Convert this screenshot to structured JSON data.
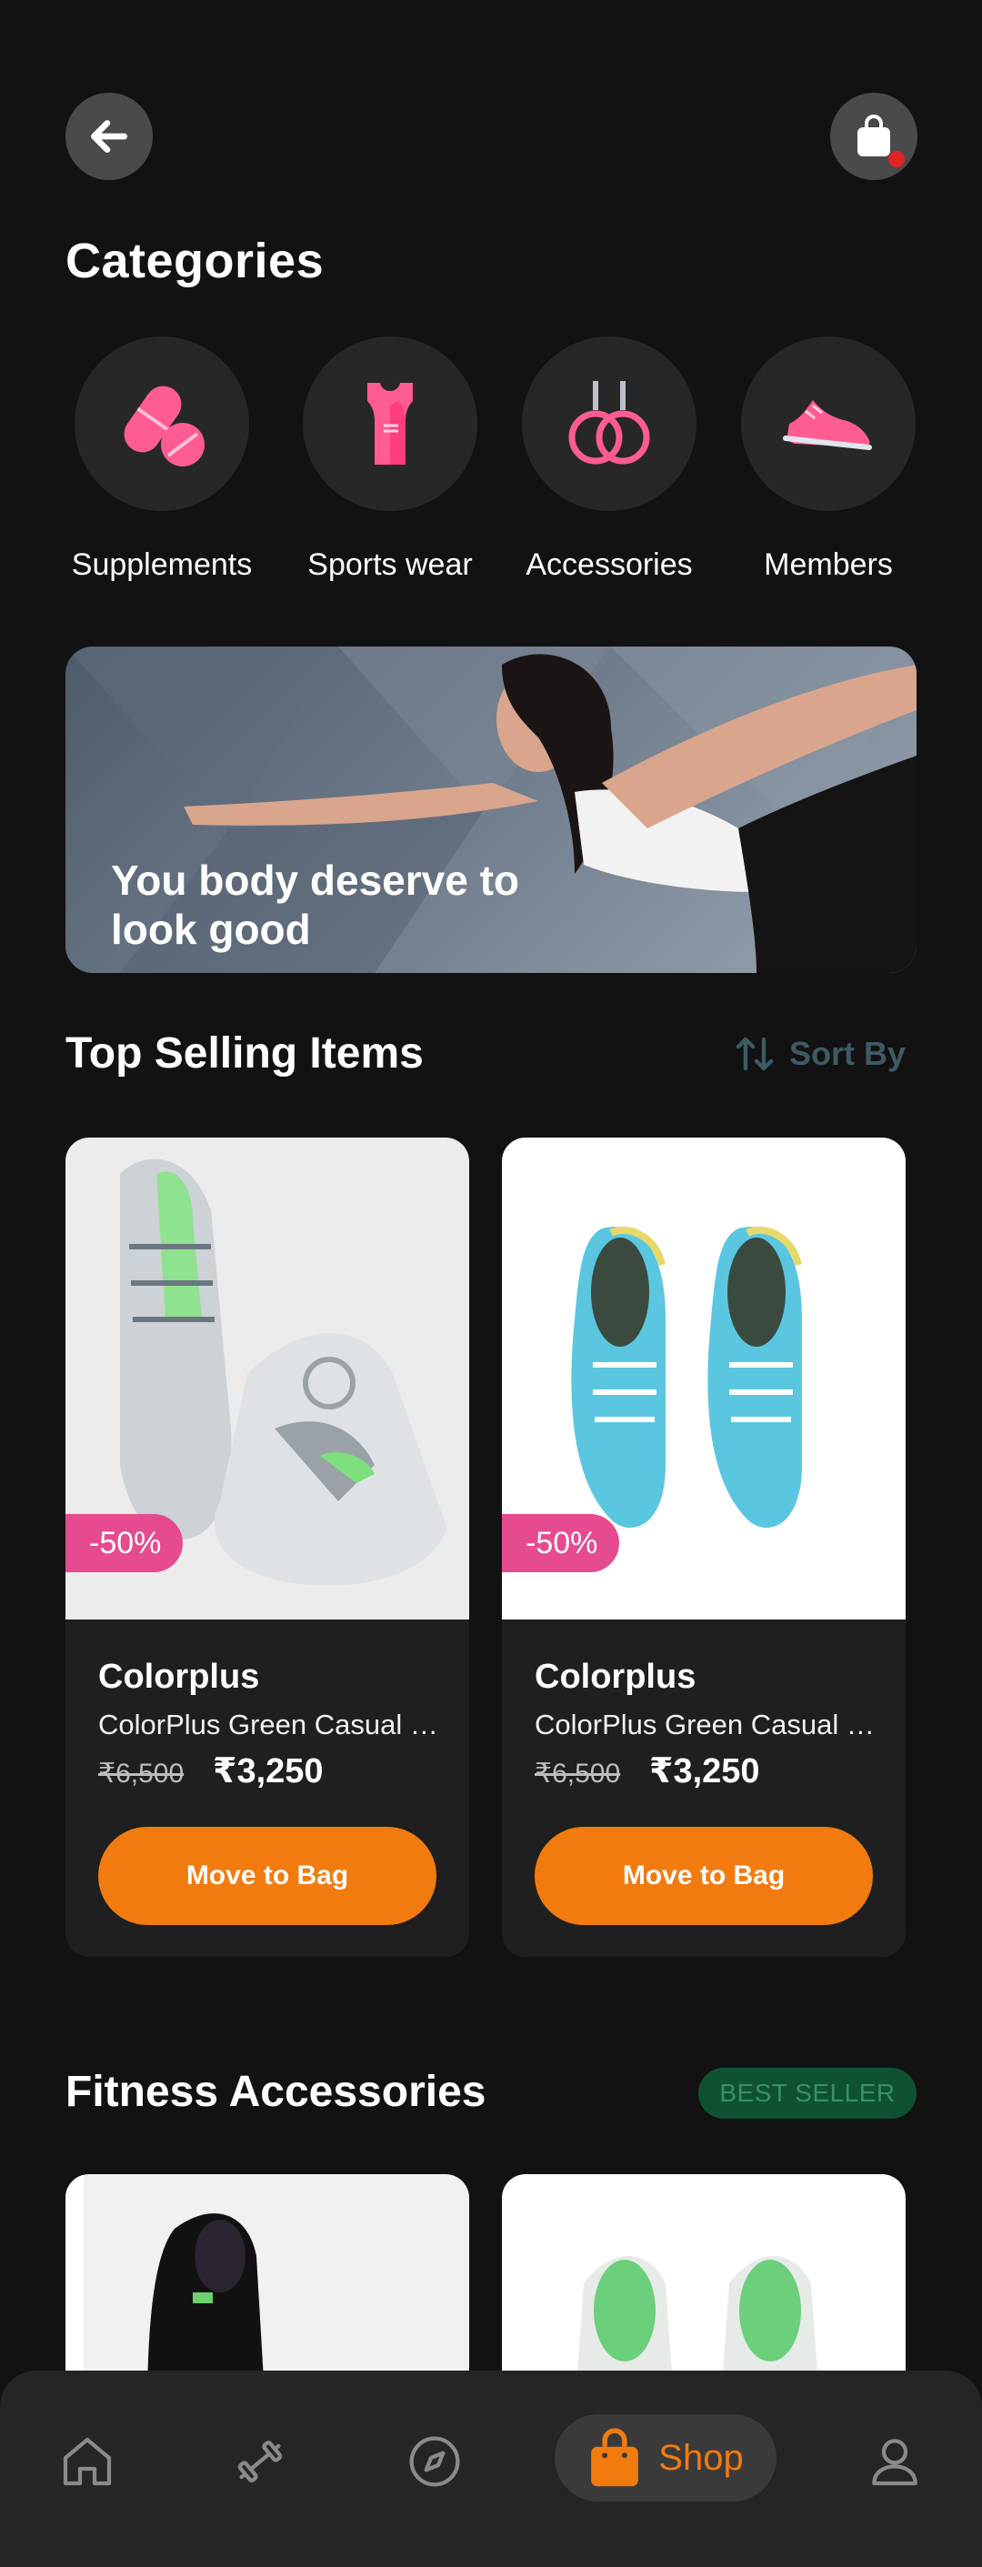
{
  "header": {
    "back_icon": "arrow-left-icon",
    "bag_icon": "shopping-bag-icon"
  },
  "categories": {
    "title": "Categories",
    "items": [
      {
        "label": "Supplements",
        "icon": "pills-icon"
      },
      {
        "label": "Sports wear",
        "icon": "tank-top-icon"
      },
      {
        "label": "Accessories",
        "icon": "gym-rings-icon"
      },
      {
        "label": "Members",
        "icon": "sneaker-icon"
      }
    ]
  },
  "banner": {
    "text": "You body deserve to look good"
  },
  "top_selling": {
    "title": "Top Selling Items",
    "sort_label": "Sort By",
    "products": [
      {
        "discount": "-50%",
        "brand": "Colorplus",
        "name": "ColorPlus Green Casual Sneakers",
        "old_price": "₹6,500",
        "price": "₹3,250",
        "button": "Move to Bag"
      },
      {
        "discount": "-50%",
        "brand": "Colorplus",
        "name": "ColorPlus Green Casual Sneakers",
        "old_price": "₹6,500",
        "price": "₹3,250",
        "button": "Move to Bag"
      }
    ]
  },
  "fitness": {
    "title": "Fitness Accessories",
    "badge": "BEST SELLER"
  },
  "bottom_nav": {
    "items": [
      {
        "icon": "home-icon"
      },
      {
        "icon": "dumbbell-icon"
      },
      {
        "icon": "compass-icon"
      },
      {
        "icon": "shopping-bag-icon",
        "label": "Shop",
        "active": true
      },
      {
        "icon": "user-icon"
      }
    ]
  },
  "colors": {
    "accent": "#f27b0f",
    "discount": "#e64a8f",
    "badge_bg": "#0f5133",
    "background": "#121212",
    "card": "#1f1f1f"
  }
}
